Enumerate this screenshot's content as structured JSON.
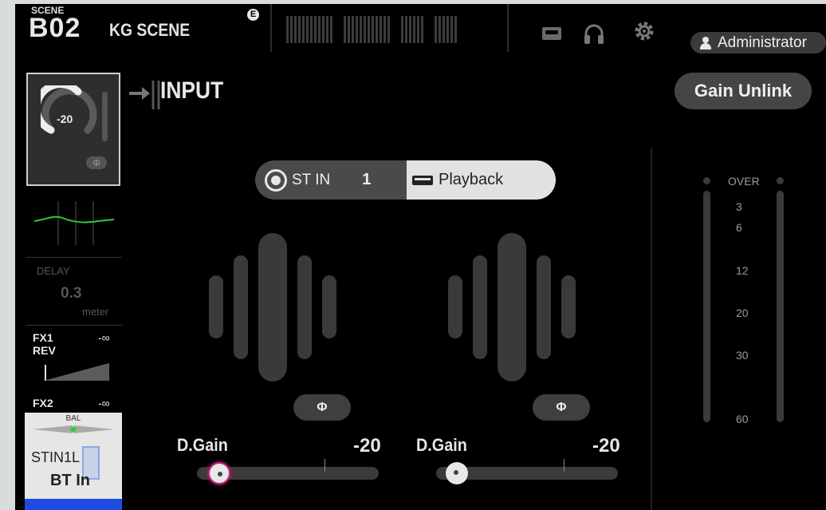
{
  "top_bar": {
    "scene_caption": "SCENE",
    "scene_number": "B02",
    "scene_name": "KG SCENE",
    "edited_badge": "E",
    "icons": [
      "recorder-icon",
      "headphones-icon",
      "gear-icon"
    ],
    "user_label": "Administrator"
  },
  "left_strip": {
    "gain_value": "-20",
    "phase_symbol": "Φ",
    "delay_label": "DELAY",
    "delay_value": "0.3",
    "delay_unit": "meter",
    "fx1_label": "FX1",
    "fx1_type": "REV",
    "fx1_value": "-∞",
    "fx2_label": "FX2",
    "fx2_value": "-∞",
    "bal_label": "BAL",
    "channel_id": "STIN1L",
    "channel_name": "BT In",
    "eq_curve_color": "#35c93a",
    "channel_color": "#1e4be0"
  },
  "header": {
    "title": "INPUT",
    "gain_unlink_label": "Gain Unlink"
  },
  "source_selector": {
    "source_label": "ST IN",
    "source_number": "1",
    "mode_label": "Playback"
  },
  "channels": [
    {
      "phase_symbol": "Φ",
      "dgain_label": "D.Gain",
      "dgain_value": "-20"
    },
    {
      "phase_symbol": "Φ",
      "dgain_label": "D.Gain",
      "dgain_value": "-20"
    }
  ],
  "meter": {
    "scale": [
      "OVER",
      "3",
      "6",
      "12",
      "20",
      "30",
      "60"
    ]
  }
}
